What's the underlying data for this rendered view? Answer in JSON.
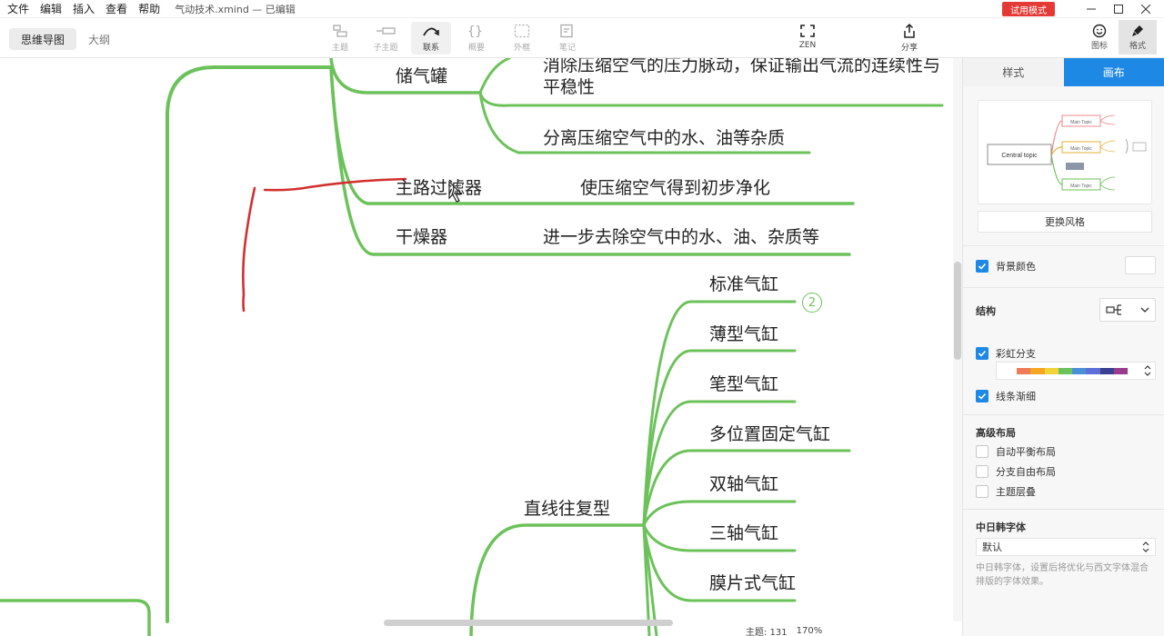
{
  "menubar": {
    "items": [
      "文件",
      "编辑",
      "插入",
      "查看",
      "帮助"
    ],
    "doc_title": "气动技术.xmind — 已编辑",
    "trial_label": "试用模式"
  },
  "toolbar": {
    "view_tabs": [
      "思维导图",
      "大纲"
    ],
    "tools": {
      "topic": "主题",
      "subtopic": "子主题",
      "relationship": "联系",
      "summary": "概要",
      "boundary": "外框",
      "note": "笔记",
      "zen": "ZEN",
      "share": "分享"
    },
    "side_toggles": {
      "icon": "图标",
      "format": "格式"
    }
  },
  "mindmap": {
    "nodes": {
      "tank": "储气罐",
      "tank_desc1": "消除压缩空气的压力脉动，保证输出气流的连续性与平稳性",
      "tank_desc2": "分离压缩空气中的水、油等杂质",
      "filter": "主路过滤器",
      "filter_desc": "使压缩空气得到初步净化",
      "dryer": "干燥器",
      "dryer_desc": "进一步去除空气中的水、油、杂质等",
      "linear": "直线往复型",
      "cyl_standard": "标准气缸",
      "cyl_thin": "薄型气缸",
      "cyl_pen": "笔型气缸",
      "cyl_multi": "多位置固定气缸",
      "cyl_dual": "双轴气缸",
      "cyl_triple": "三轴气缸",
      "cyl_membrane": "膜片式气缸"
    },
    "collapsed_count": "2",
    "branch_color": "#6cc25a",
    "ink_color": "#d32f2f"
  },
  "statusbar": {
    "topic_count": "主题: 131",
    "zoom": "170%"
  },
  "panel": {
    "tabs": [
      "样式",
      "画布"
    ],
    "preview": {
      "central": "Central topic",
      "main1": "Main Topic",
      "main2": "Main Topic",
      "main3": "Main Topic"
    },
    "change_style": "更换风格",
    "bg_color_label": "背景颜色",
    "structure_label": "结构",
    "rainbow_label": "彩虹分支",
    "taper_label": "线条渐细",
    "advanced_label": "高级布局",
    "auto_balance": "自动平衡布局",
    "free_branch": "分支自由布局",
    "overlap": "主题层叠",
    "cjk_font_label": "中日韩字体",
    "cjk_font_value": "默认",
    "cjk_font_desc": "中日韩字体，设置后将优化与西文字体混合排版的字体效果。",
    "rainbow_colors": [
      "#f07b5a",
      "#f5a623",
      "#f2d43a",
      "#6cc25a",
      "#4a90d9",
      "#5b6fd6",
      "#3a3f8f",
      "#9a3b8f"
    ],
    "accent": "#1e88e5"
  }
}
